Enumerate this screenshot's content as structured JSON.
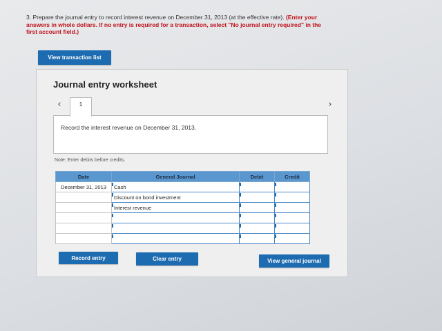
{
  "question": {
    "prefix": "3. Prepare the journal entry to record interest revenue on December 31, 2013 (at the effective rate).",
    "warning": "(Enter your answers in whole dollars. If no entry is required for a transaction, select \"No journal entry required\" in the first account field.)"
  },
  "buttons": {
    "view_transaction_list": "View transaction list",
    "record_entry": "Record entry",
    "clear_entry": "Clear entry",
    "view_general_journal": "View general journal"
  },
  "worksheet": {
    "title": "Journal entry worksheet",
    "tab_label": "1",
    "prev_arrow": "‹",
    "next_arrow": "›",
    "instruction": "Record the interest revenue on December 31, 2013.",
    "note": "Note: Enter debits before credits."
  },
  "journal": {
    "headers": {
      "date": "Date",
      "account": "General Journal",
      "debit": "Debit",
      "credit": "Credit"
    },
    "rows": [
      {
        "date": "December 31, 2013",
        "account": "Cash",
        "debit": "",
        "credit": ""
      },
      {
        "date": "",
        "account": "Discount on bond investment",
        "debit": "",
        "credit": ""
      },
      {
        "date": "",
        "account": "Interest revenue",
        "debit": "",
        "credit": ""
      },
      {
        "date": "",
        "account": "",
        "debit": "",
        "credit": ""
      },
      {
        "date": "",
        "account": "",
        "debit": "",
        "credit": ""
      },
      {
        "date": "",
        "account": "",
        "debit": "",
        "credit": ""
      }
    ]
  },
  "colors": {
    "button_blue": "#1d6bb0",
    "header_blue": "#5b97cf",
    "warning_red": "#c0141e"
  }
}
